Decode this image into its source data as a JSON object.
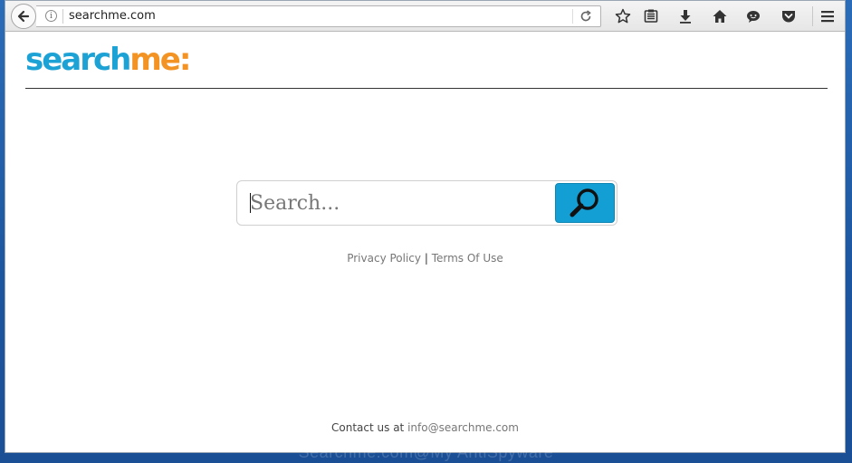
{
  "browser": {
    "url": "searchme.com",
    "info_glyph": "i"
  },
  "logo": {
    "part1": "search",
    "part2": "me:"
  },
  "search": {
    "placeholder": "Search..."
  },
  "links": {
    "privacy": "Privacy Policy",
    "separator": "|",
    "terms": "Terms Of Use"
  },
  "contact": {
    "prefix": "Contact us at",
    "email": "info@searchme.com"
  },
  "watermark": "Searchme.com@My AntiSpyware",
  "colors": {
    "logo_blue": "#1da2d6",
    "logo_orange": "#f39323",
    "search_button": "#139fd3"
  }
}
